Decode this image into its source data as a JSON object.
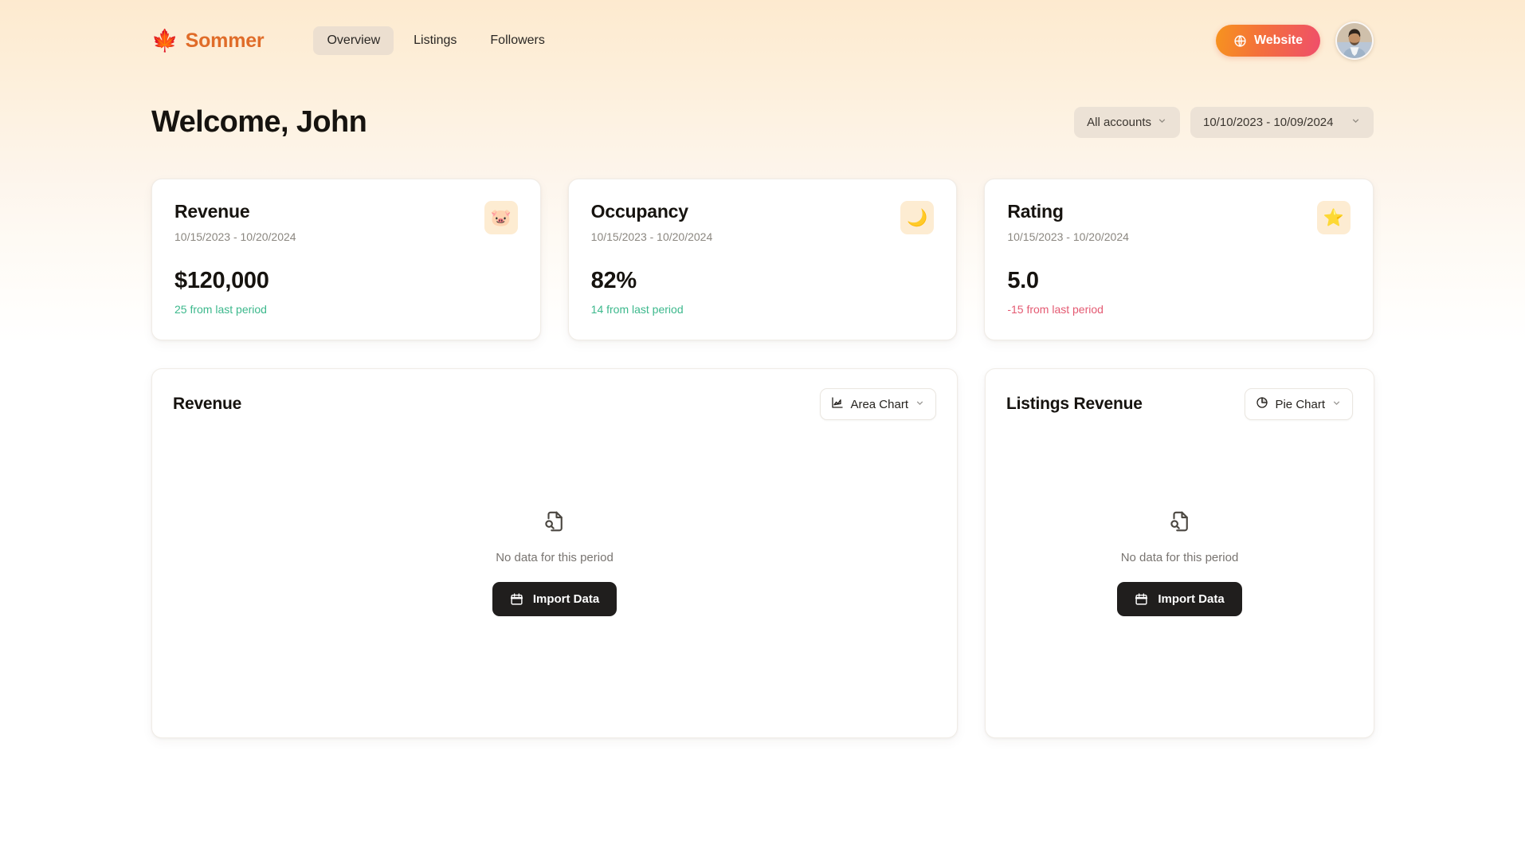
{
  "brand": {
    "leaf_icon": "maple-leaf-icon",
    "name": "Sommer"
  },
  "nav": {
    "items": [
      {
        "label": "Overview",
        "active": true
      },
      {
        "label": "Listings",
        "active": false
      },
      {
        "label": "Followers",
        "active": false
      }
    ]
  },
  "header": {
    "website_button": "Website",
    "website_icon": "globe-icon",
    "avatar_alt": "user-avatar"
  },
  "welcome": {
    "title": "Welcome, John",
    "account_filter": "All accounts",
    "date_range": "10/10/2023 - 10/09/2024"
  },
  "colors": {
    "brand_orange": "#e06c29",
    "accent_gradient_start": "#f7941e",
    "accent_gradient_end": "#ef4e6b",
    "positive": "#3cb88c",
    "negative": "#e45a72",
    "icon_tile_bg": "#fdecd2",
    "pill_bg": "#ece2d6",
    "button_dark": "#201e1d"
  },
  "stats": [
    {
      "title": "Revenue",
      "range": "10/15/2023 - 10/20/2024",
      "value": "$120,000",
      "delta": "25 from last period",
      "delta_direction": "up",
      "icon": "piggy-bank-icon",
      "icon_glyph": "🐷"
    },
    {
      "title": "Occupancy",
      "range": "10/15/2023 - 10/20/2024",
      "value": "82%",
      "delta": "14 from last period",
      "delta_direction": "up",
      "icon": "crescent-moon-icon",
      "icon_glyph": "🌙"
    },
    {
      "title": "Rating",
      "range": "10/15/2023 - 10/20/2024",
      "value": "5.0",
      "delta": "-15 from last period",
      "delta_direction": "down",
      "icon": "star-icon",
      "icon_glyph": "⭐"
    }
  ],
  "charts": [
    {
      "title": "Revenue",
      "selector_label": "Area Chart",
      "selector_icon": "area-chart-icon",
      "empty_icon": "file-search-icon",
      "empty_text": "No data for this period",
      "import_label": "Import Data",
      "import_icon": "calendar-icon"
    },
    {
      "title": "Listings Revenue",
      "selector_label": "Pie Chart",
      "selector_icon": "pie-chart-icon",
      "empty_icon": "file-search-icon",
      "empty_text": "No data for this period",
      "import_label": "Import Data",
      "import_icon": "calendar-icon"
    }
  ]
}
